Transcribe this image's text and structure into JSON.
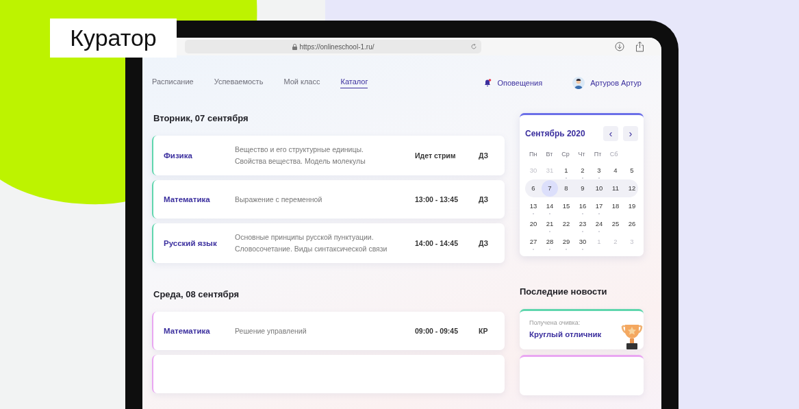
{
  "badge": {
    "label": "Куратор"
  },
  "browser": {
    "url": "https://onlineschool-1.ru/"
  },
  "nav": {
    "tabs": [
      {
        "label": "Расписание",
        "selected": false
      },
      {
        "label": "Успеваемость",
        "selected": false
      },
      {
        "label": "Мой класс",
        "selected": false
      },
      {
        "label": "Каталог",
        "selected": true
      }
    ],
    "notifications": {
      "label": "Оповещения",
      "unread": true
    },
    "user": {
      "name": "Артуров Артур"
    }
  },
  "days": [
    {
      "title": "Вторник, 07 сентября",
      "lessons": [
        {
          "subject": "Физика",
          "topic": "Вещество и его структурные единицы. Свойства вещества. Модель молекулы",
          "time": "Идет стрим",
          "task": "ДЗ",
          "color": "#5fd6ad"
        },
        {
          "subject": "Математика",
          "topic": "Выражение с переменной",
          "time": "13:00 - 13:45",
          "task": "ДЗ",
          "color": "#5fd6ad"
        },
        {
          "subject": "Русский язык",
          "topic": "Основные принципы русской пунктуации. Словосочетание. Виды синтаксической связи",
          "time": "14:00 - 14:45",
          "task": "ДЗ",
          "color": "#5fd6ad"
        }
      ]
    },
    {
      "title": "Среда, 08 сентября",
      "lessons": [
        {
          "subject": "Математика",
          "topic": "Решение управлений",
          "time": "09:00 - 09:45",
          "task": "КР",
          "color": "#e9a6f2"
        },
        {
          "color": "#e9a6f2"
        }
      ]
    }
  ],
  "calendar": {
    "title": "Сентябрь 2020",
    "prev": "‹",
    "next": "›",
    "weekdays": [
      {
        "label": "Пн",
        "muted": false
      },
      {
        "label": "Вт",
        "muted": false
      },
      {
        "label": "Ср",
        "muted": false
      },
      {
        "label": "Чт",
        "muted": false
      },
      {
        "label": "Пт",
        "muted": false
      },
      {
        "label": "Сб",
        "muted": true
      }
    ],
    "weeks": [
      {
        "current": false,
        "days": [
          {
            "label": "30",
            "other_month": true,
            "dot": false,
            "selected": false
          },
          {
            "label": "31",
            "other_month": true,
            "dot": false,
            "selected": false
          },
          {
            "label": "1",
            "other_month": false,
            "dot": true,
            "selected": false
          },
          {
            "label": "2",
            "other_month": false,
            "dot": true,
            "selected": false
          },
          {
            "label": "3",
            "other_month": false,
            "dot": true,
            "selected": false
          },
          {
            "label": "4",
            "other_month": false,
            "dot": false,
            "selected": false
          },
          {
            "label": "5",
            "other_month": false,
            "dot": false,
            "selected": false
          }
        ]
      },
      {
        "current": true,
        "days": [
          {
            "label": "6",
            "other_month": false,
            "dot": false,
            "selected": false
          },
          {
            "label": "7",
            "other_month": false,
            "dot": false,
            "selected": true
          },
          {
            "label": "8",
            "other_month": false,
            "dot": false,
            "selected": false
          },
          {
            "label": "9",
            "other_month": false,
            "dot": false,
            "selected": false
          },
          {
            "label": "10",
            "other_month": false,
            "dot": false,
            "selected": false
          },
          {
            "label": "11",
            "other_month": false,
            "dot": false,
            "selected": false
          },
          {
            "label": "12",
            "other_month": false,
            "dot": false,
            "selected": false
          }
        ]
      },
      {
        "current": false,
        "days": [
          {
            "label": "13",
            "other_month": false,
            "dot": true,
            "selected": false
          },
          {
            "label": "14",
            "other_month": false,
            "dot": true,
            "selected": false
          },
          {
            "label": "15",
            "other_month": false,
            "dot": false,
            "selected": false
          },
          {
            "label": "16",
            "other_month": false,
            "dot": true,
            "selected": false
          },
          {
            "label": "17",
            "other_month": false,
            "dot": true,
            "selected": false
          },
          {
            "label": "18",
            "other_month": false,
            "dot": false,
            "selected": false
          },
          {
            "label": "19",
            "other_month": false,
            "dot": false,
            "selected": false
          }
        ]
      },
      {
        "current": false,
        "days": [
          {
            "label": "20",
            "other_month": false,
            "dot": false,
            "selected": false
          },
          {
            "label": "21",
            "other_month": false,
            "dot": true,
            "selected": false
          },
          {
            "label": "22",
            "other_month": false,
            "dot": false,
            "selected": false
          },
          {
            "label": "23",
            "other_month": false,
            "dot": true,
            "selected": false
          },
          {
            "label": "24",
            "other_month": false,
            "dot": true,
            "selected": false
          },
          {
            "label": "25",
            "other_month": false,
            "dot": false,
            "selected": false
          },
          {
            "label": "26",
            "other_month": false,
            "dot": false,
            "selected": false
          }
        ]
      },
      {
        "current": false,
        "days": [
          {
            "label": "27",
            "other_month": false,
            "dot": true,
            "selected": false
          },
          {
            "label": "28",
            "other_month": false,
            "dot": true,
            "selected": false
          },
          {
            "label": "29",
            "other_month": false,
            "dot": true,
            "selected": false
          },
          {
            "label": "30",
            "other_month": false,
            "dot": true,
            "selected": false
          },
          {
            "label": "1",
            "other_month": true,
            "dot": false,
            "selected": false
          },
          {
            "label": "2",
            "other_month": true,
            "dot": false,
            "selected": false
          },
          {
            "label": "3",
            "other_month": true,
            "dot": false,
            "selected": false
          }
        ]
      }
    ]
  },
  "news": {
    "title": "Последние новости",
    "items": [
      {
        "kind": "achievement",
        "caption": "Получена очивка:",
        "title": "Круглый отличник",
        "color": "#5fd6ad"
      },
      {
        "kind": "empty",
        "color": "#e9a6f2"
      }
    ]
  }
}
